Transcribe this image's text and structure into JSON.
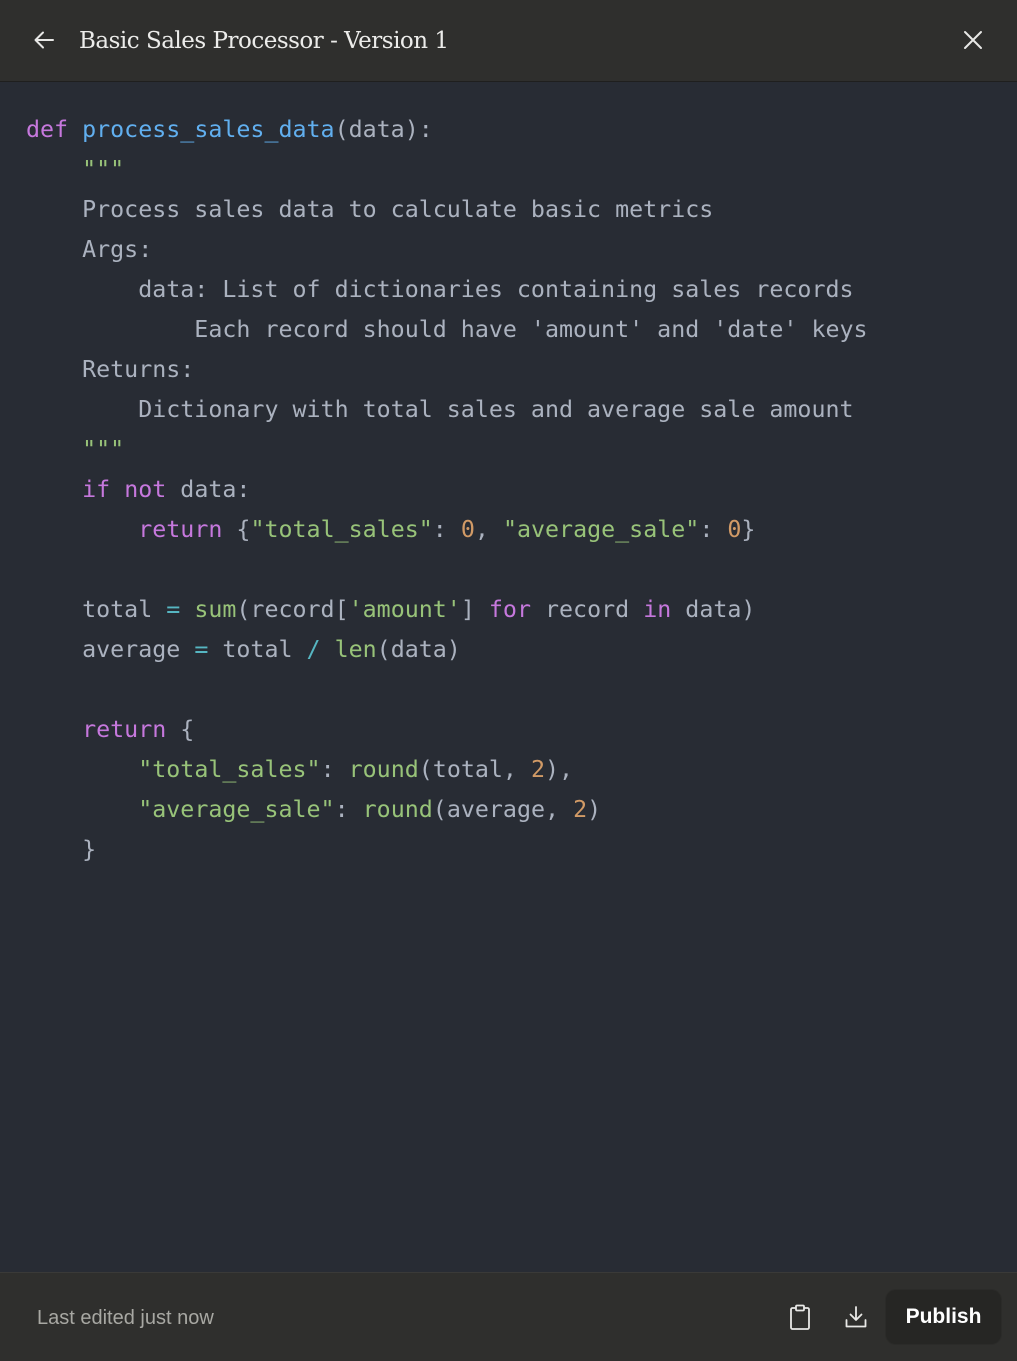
{
  "header": {
    "title": "Basic Sales Processor - Version 1",
    "back_icon": "arrow-left-icon",
    "close_icon": "close-icon"
  },
  "code": {
    "language": "python",
    "lines": [
      [
        {
          "t": "kw",
          "v": "def"
        },
        {
          "t": "p",
          "v": " "
        },
        {
          "t": "fn",
          "v": "process_sales_data"
        },
        {
          "t": "p",
          "v": "(data):"
        }
      ],
      [
        {
          "t": "str",
          "v": "    \"\"\""
        }
      ],
      [
        {
          "t": "p",
          "v": "    Process sales data to calculate basic metrics"
        }
      ],
      [
        {
          "t": "p",
          "v": "    Args:"
        }
      ],
      [
        {
          "t": "p",
          "v": "        data: List of dictionaries containing sales records"
        }
      ],
      [
        {
          "t": "p",
          "v": "            Each record should have 'amount' and 'date' keys"
        }
      ],
      [
        {
          "t": "p",
          "v": "    Returns:"
        }
      ],
      [
        {
          "t": "p",
          "v": "        Dictionary with total sales and average sale amount"
        }
      ],
      [
        {
          "t": "str",
          "v": "    \"\"\""
        }
      ],
      [
        {
          "t": "p",
          "v": "    "
        },
        {
          "t": "kw",
          "v": "if"
        },
        {
          "t": "p",
          "v": " "
        },
        {
          "t": "kw",
          "v": "not"
        },
        {
          "t": "p",
          "v": " data:"
        }
      ],
      [
        {
          "t": "p",
          "v": "        "
        },
        {
          "t": "kw",
          "v": "return"
        },
        {
          "t": "p",
          "v": " {"
        },
        {
          "t": "str",
          "v": "\"total_sales\""
        },
        {
          "t": "p",
          "v": ": "
        },
        {
          "t": "num",
          "v": "0"
        },
        {
          "t": "p",
          "v": ", "
        },
        {
          "t": "str",
          "v": "\"average_sale\""
        },
        {
          "t": "p",
          "v": ": "
        },
        {
          "t": "num",
          "v": "0"
        },
        {
          "t": "p",
          "v": "}"
        }
      ],
      [
        {
          "t": "p",
          "v": ""
        }
      ],
      [
        {
          "t": "p",
          "v": "    total "
        },
        {
          "t": "op",
          "v": "="
        },
        {
          "t": "p",
          "v": " "
        },
        {
          "t": "bi",
          "v": "sum"
        },
        {
          "t": "p",
          "v": "(record["
        },
        {
          "t": "str",
          "v": "'amount'"
        },
        {
          "t": "p",
          "v": "] "
        },
        {
          "t": "kw",
          "v": "for"
        },
        {
          "t": "p",
          "v": " record "
        },
        {
          "t": "kw",
          "v": "in"
        },
        {
          "t": "p",
          "v": " data)"
        }
      ],
      [
        {
          "t": "p",
          "v": "    average "
        },
        {
          "t": "op",
          "v": "="
        },
        {
          "t": "p",
          "v": " total "
        },
        {
          "t": "op",
          "v": "/"
        },
        {
          "t": "p",
          "v": " "
        },
        {
          "t": "bi",
          "v": "len"
        },
        {
          "t": "p",
          "v": "(data)"
        }
      ],
      [
        {
          "t": "p",
          "v": ""
        }
      ],
      [
        {
          "t": "p",
          "v": "    "
        },
        {
          "t": "kw",
          "v": "return"
        },
        {
          "t": "p",
          "v": " {"
        }
      ],
      [
        {
          "t": "p",
          "v": "        "
        },
        {
          "t": "str",
          "v": "\"total_sales\""
        },
        {
          "t": "p",
          "v": ": "
        },
        {
          "t": "bi",
          "v": "round"
        },
        {
          "t": "p",
          "v": "(total, "
        },
        {
          "t": "num",
          "v": "2"
        },
        {
          "t": "p",
          "v": "),"
        }
      ],
      [
        {
          "t": "p",
          "v": "        "
        },
        {
          "t": "str",
          "v": "\"average_sale\""
        },
        {
          "t": "p",
          "v": ": "
        },
        {
          "t": "bi",
          "v": "round"
        },
        {
          "t": "p",
          "v": "(average, "
        },
        {
          "t": "num",
          "v": "2"
        },
        {
          "t": "p",
          "v": ")"
        }
      ],
      [
        {
          "t": "p",
          "v": "    }"
        }
      ]
    ]
  },
  "footer": {
    "status": "Last edited just now",
    "copy_icon": "clipboard-icon",
    "download_icon": "download-icon",
    "publish_label": "Publish"
  },
  "colors": {
    "keyword": "#c678dd",
    "function": "#61afef",
    "string": "#98c379",
    "number": "#d19a66",
    "operator": "#56b6c2",
    "plain": "#abb2bf",
    "code_background": "#282c34",
    "chrome_background": "#2f2f2d"
  }
}
